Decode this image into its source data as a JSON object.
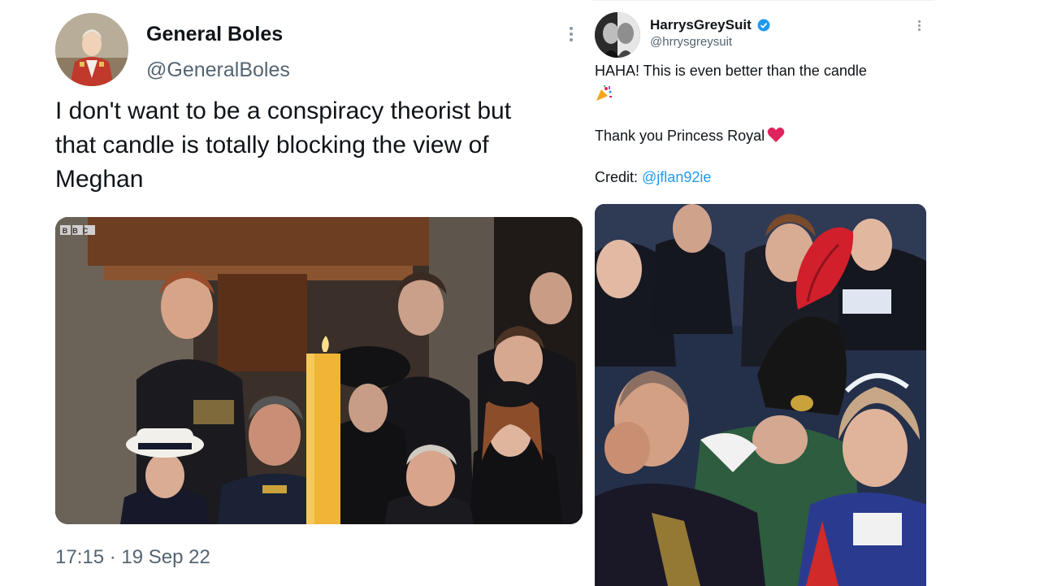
{
  "left_tweet": {
    "author_name": "General Boles",
    "author_handle": "@GeneralBoles",
    "text_lines": [
      "I don't want to be a conspiracy theorist but",
      "that candle is totally blocking the view of",
      "Meghan"
    ],
    "media_watermark": "BBC",
    "timestamp": "17:15 · 19 Sep 22"
  },
  "right_tweet": {
    "author_name": "HarrysGreySuit",
    "author_handle": "@hrrysgreysuit",
    "line1": "HAHA! This is even better than the candle",
    "line2": "Thank you Princess Royal",
    "credit_label": "Credit: ",
    "credit_link": "@jflan92ie"
  },
  "icons": {
    "more": "more-options-icon",
    "verified": "verified-badge-icon",
    "party": "party-popper-emoji",
    "heart": "red-heart-emoji"
  },
  "colors": {
    "text": "#0f1419",
    "secondary": "#536471",
    "link": "#1d9bf0",
    "verified": "#1d9bf0",
    "heart": "#e0245e"
  }
}
